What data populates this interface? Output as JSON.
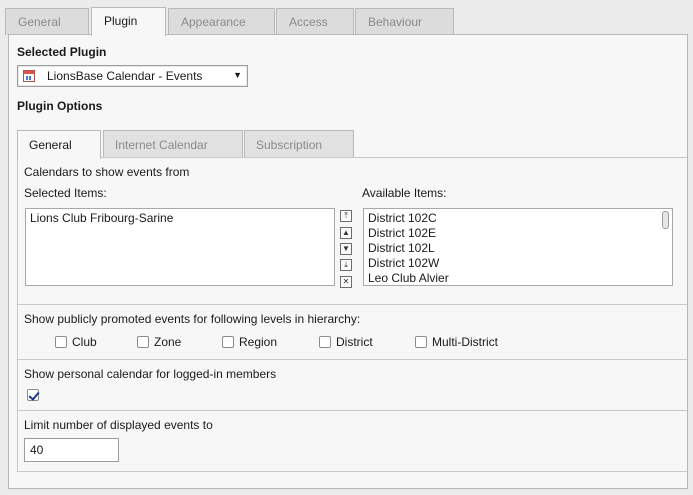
{
  "top_tabs": [
    {
      "label": "General",
      "active": false
    },
    {
      "label": "Plugin",
      "active": true
    },
    {
      "label": "Appearance",
      "active": false
    },
    {
      "label": "Access",
      "active": false
    },
    {
      "label": "Behaviour",
      "active": false
    }
  ],
  "selected_plugin": {
    "heading": "Selected Plugin",
    "value": "LionsBase Calendar - Events",
    "icon": "calendar-icon"
  },
  "plugin_options": {
    "heading": "Plugin Options",
    "tabs": [
      {
        "label": "General",
        "active": true
      },
      {
        "label": "Internet Calendar",
        "active": false
      },
      {
        "label": "Subscription",
        "active": false
      }
    ]
  },
  "calendars": {
    "title": "Calendars to show events from",
    "selected_label": "Selected Items:",
    "available_label": "Available Items:",
    "selected_items": [
      "Lions Club Fribourg-Sarine"
    ],
    "available_items": [
      "District 102C",
      "District 102E",
      "District 102L",
      "District 102W",
      "Leo Club Alvier"
    ],
    "controls": [
      "move-top-icon",
      "move-up-icon",
      "move-down-icon",
      "move-bottom-icon",
      "remove-icon"
    ]
  },
  "promoted": {
    "title": "Show publicly promoted events for following levels in hierarchy:",
    "options": [
      {
        "label": "Club",
        "checked": false
      },
      {
        "label": "Zone",
        "checked": false
      },
      {
        "label": "Region",
        "checked": false
      },
      {
        "label": "District",
        "checked": false
      },
      {
        "label": "Multi-District",
        "checked": false
      }
    ]
  },
  "personal": {
    "title": "Show personal calendar for logged-in members",
    "checked": true
  },
  "limit": {
    "title": "Limit number of displayed events to",
    "value": "40"
  }
}
